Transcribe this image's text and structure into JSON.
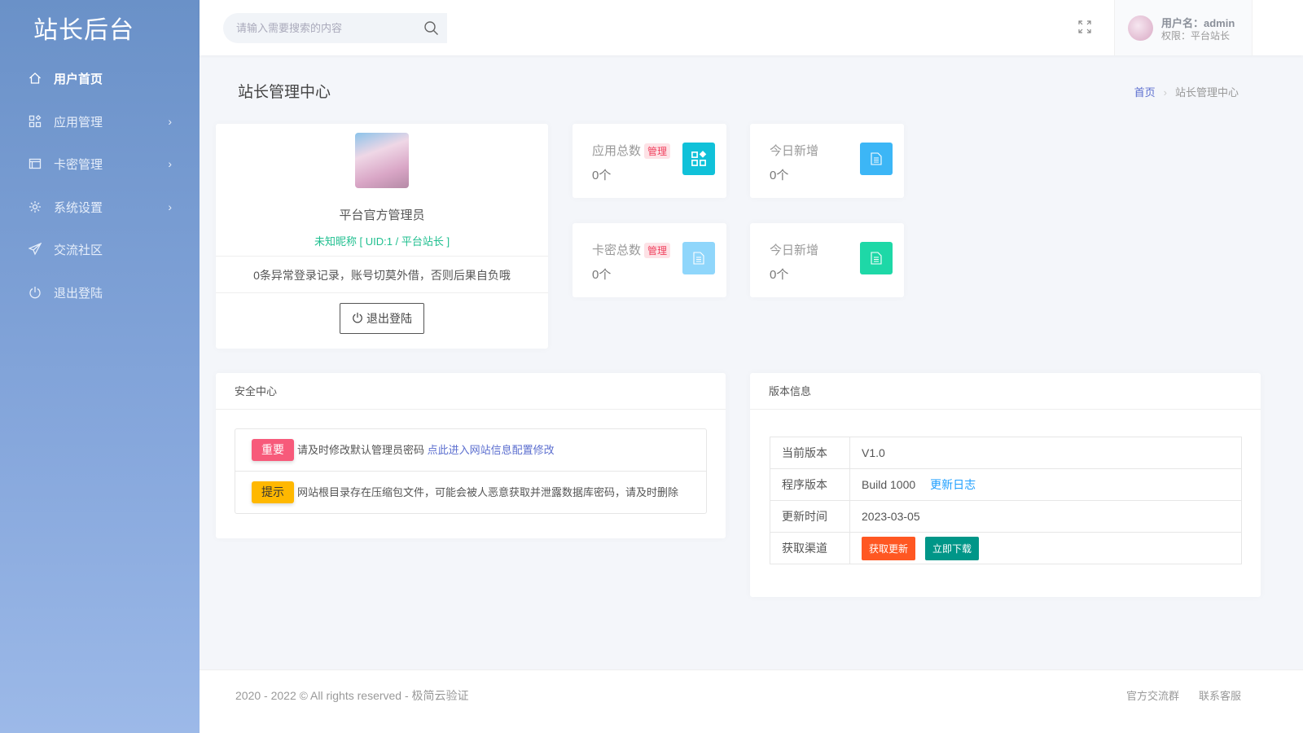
{
  "sidebar": {
    "logo": "站长后台",
    "items": [
      {
        "label": "用户首页",
        "icon": "home-icon",
        "active": true
      },
      {
        "label": "应用管理",
        "icon": "apps-icon",
        "chevron": true
      },
      {
        "label": "卡密管理",
        "icon": "card-icon",
        "chevron": true
      },
      {
        "label": "系统设置",
        "icon": "gear-icon",
        "chevron": true
      },
      {
        "label": "交流社区",
        "icon": "send-icon"
      },
      {
        "label": "退出登陆",
        "icon": "power-icon"
      }
    ]
  },
  "header": {
    "search_placeholder": "请输入需要搜索的内容",
    "user_name": "用户名：admin",
    "user_role": "权限：平台站长"
  },
  "page": {
    "title": "站长管理中心",
    "breadcrumb": [
      "首页",
      "站长管理中心"
    ]
  },
  "profile": {
    "name": "平台官方管理员",
    "nick": "未知昵称 [ UID:1 / 平台站长 ]",
    "notice": "0条异常登录记录，账号切莫外借，否则后果自负哦",
    "logout": "退出登陆"
  },
  "stats": [
    {
      "label": "应用总数",
      "badge": "管理",
      "value": "0个",
      "color": "#10c1d9"
    },
    {
      "label": "今日新增",
      "value": "0个",
      "color": "#3cb6f6"
    },
    {
      "label": "卡密总数",
      "badge": "管理",
      "value": "0个",
      "color": "#8fd6fb"
    },
    {
      "label": "今日新增",
      "value": "0个",
      "color": "#1ed8a7"
    }
  ],
  "security": {
    "title": "安全中心",
    "rows": [
      {
        "tag": "重要",
        "text": "请及时修改默认管理员密码 ",
        "link": "点此进入网站信息配置修改"
      },
      {
        "tag": "提示",
        "text": "网站根目录存在压缩包文件，可能会被人恶意获取并泄露数据库密码，请及时删除"
      }
    ]
  },
  "version": {
    "title": "版本信息",
    "rows": [
      {
        "label": "当前版本",
        "value": "V1.0"
      },
      {
        "label": "程序版本",
        "value": "Build 1000",
        "link": "更新日志"
      },
      {
        "label": "更新时间",
        "value": "2023-03-05"
      },
      {
        "label": "获取渠道",
        "buttons": [
          "获取更新",
          "立即下载"
        ]
      }
    ]
  },
  "footer": {
    "copyright": "2020 - 2022 © All rights reserved - 极简云验证",
    "links": [
      "官方交流群",
      "联系客服"
    ]
  }
}
